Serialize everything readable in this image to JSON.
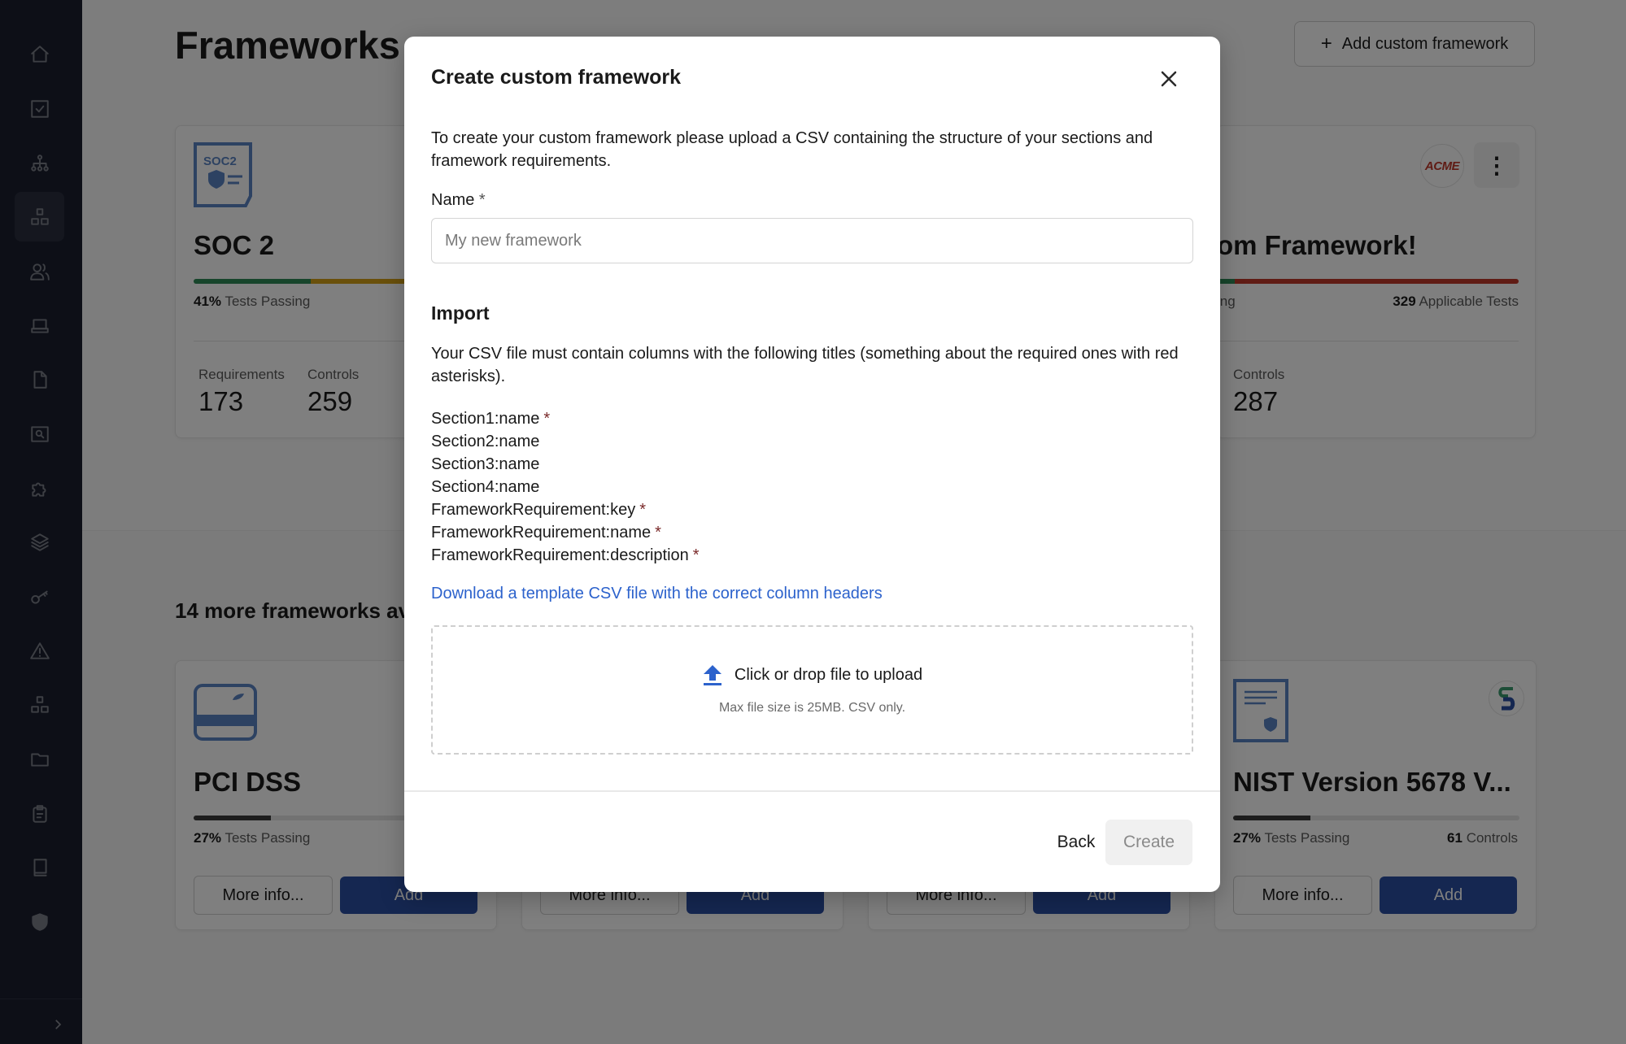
{
  "sidebar": {
    "items": [
      {
        "icon": "home-icon"
      },
      {
        "icon": "checkbox-icon"
      },
      {
        "icon": "org-chart-icon"
      },
      {
        "icon": "frameworks-icon",
        "active": true
      },
      {
        "icon": "users-icon"
      },
      {
        "icon": "laptop-icon"
      },
      {
        "icon": "document-icon"
      },
      {
        "icon": "search-document-icon"
      },
      {
        "icon": "puzzle-icon"
      },
      {
        "icon": "layers-icon"
      },
      {
        "icon": "key-icon"
      },
      {
        "icon": "warning-icon"
      },
      {
        "icon": "blocks-icon"
      },
      {
        "icon": "folder-icon"
      },
      {
        "icon": "clipboard-icon"
      },
      {
        "icon": "book-icon"
      },
      {
        "icon": "shield-icon"
      }
    ],
    "expand_icon": "chevron-right-icon"
  },
  "page": {
    "title": "Frameworks",
    "add_custom_label": "Add custom framework",
    "add_custom_icon": "+"
  },
  "active_frameworks": [
    {
      "name": "SOC 2",
      "logo_text": "SOC2",
      "passing_pct": "41%",
      "passing_label": "Tests Passing",
      "progress": {
        "pass": 0.41,
        "warn": 0.59,
        "fail": 0
      },
      "metrics": [
        {
          "label": "Requirements",
          "value": "173"
        },
        {
          "label": "Controls",
          "value": "259"
        }
      ]
    },
    {
      "name": "om Framework!",
      "badge": "ACME",
      "menu_icon": "⋮",
      "passing_label_partial": "ing",
      "applicable_count": "329",
      "applicable_label": "Applicable Tests",
      "progress": {
        "pass": 0.06,
        "warn": 0,
        "fail": 0.94
      },
      "metrics": [
        {
          "label": "Controls",
          "value": "287"
        }
      ]
    }
  ],
  "more_heading": "14 more frameworks av",
  "available_frameworks": [
    {
      "name": "PCI DSS",
      "passing_pct": "27%",
      "passing_label": "Tests Passing",
      "progress": 0.27,
      "more_label": "More info...",
      "add_label": "Add"
    },
    {
      "more_label": "More info...",
      "add_label": "Add"
    },
    {
      "more_label": "More info...",
      "add_label": "Add"
    },
    {
      "name": "NIST Version 5678 V...",
      "passing_pct": "27%",
      "passing_label": "Tests Passing",
      "controls_count": "61",
      "controls_label": "Controls",
      "progress": 0.27,
      "more_label": "More info...",
      "add_label": "Add"
    }
  ],
  "modal": {
    "title": "Create custom framework",
    "intro": "To create your custom framework please upload a CSV containing the structure of your sections and framework requirements.",
    "name_label": "Name",
    "name_required": "*",
    "name_placeholder": "My new framework",
    "name_value": "",
    "import_heading": "Import",
    "import_text": "Your CSV file must contain columns with the following titles (something about the required ones with red asterisks).",
    "columns": [
      {
        "name": "Section1:name",
        "required": "*"
      },
      {
        "name": "Section2:name",
        "required": ""
      },
      {
        "name": "Section3:name",
        "required": ""
      },
      {
        "name": "Section4:name",
        "required": ""
      },
      {
        "name": "FrameworkRequirement:key",
        "required": "*"
      },
      {
        "name": "FrameworkRequirement:name",
        "required": "*"
      },
      {
        "name": "FrameworkRequirement:description",
        "required": "*"
      }
    ],
    "download_link": "Download a template CSV file with the correct column headers",
    "upload_label": "Click or drop file to upload",
    "upload_hint": "Max file size is 25MB. CSV only.",
    "back_label": "Back",
    "create_label": "Create"
  },
  "colors": {
    "sidebar_bg": "#1a1e2e",
    "primary": "#2b4ea2",
    "link": "#2c62cc",
    "pass": "#2e8b57",
    "warn": "#d4a017",
    "fail": "#c0392b"
  }
}
